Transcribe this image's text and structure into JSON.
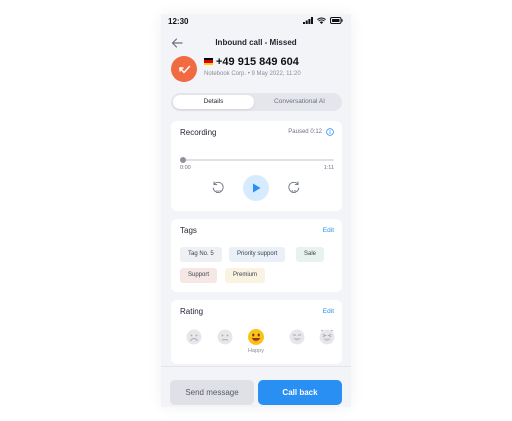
{
  "status_bar": {
    "time": "12:30"
  },
  "header": {
    "title": "Inbound call - Missed"
  },
  "caller": {
    "number": "+49 915 849 604",
    "meta": "Notebook Corp.  •  9 May 2022,  11:20",
    "flag_colors": [
      "#000000",
      "#dd0000",
      "#ffce00"
    ],
    "avatar_color": "#f06a42"
  },
  "tabs": [
    {
      "label": "Details",
      "active": true
    },
    {
      "label": "Conversational AI",
      "active": false
    }
  ],
  "recording": {
    "title": "Recording",
    "status": "Paused 0:12",
    "time_start": "0:00",
    "time_end": "1:11",
    "rewind_label": "10",
    "forward_label": "10",
    "progress": 0
  },
  "tags": {
    "title": "Tags",
    "edit_label": "Edit",
    "items": [
      "Tag No. 5",
      "Priority support",
      "Sale",
      "Support",
      "Premium"
    ]
  },
  "rating": {
    "title": "Rating",
    "edit_label": "Edit",
    "selected_label": "Happy"
  },
  "actions": {
    "send_label": "Send message",
    "call_label": "Call back"
  },
  "colors": {
    "accent": "#2a8ff2",
    "avatar": "#f06a42",
    "background": "#f3f4f8"
  }
}
